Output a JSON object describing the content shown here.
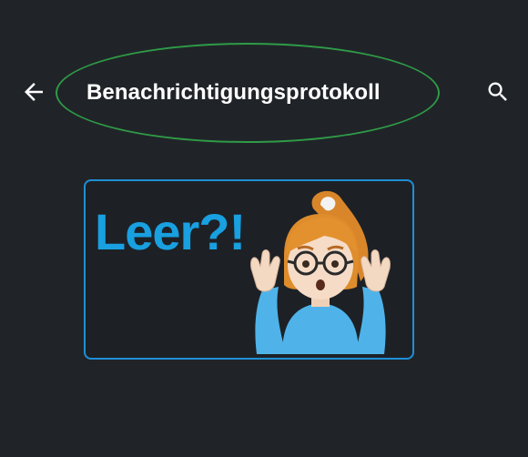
{
  "header": {
    "title": "Benachrichtigungsprotokoll",
    "back_icon": "arrow-left-icon",
    "search_icon": "search-icon",
    "highlight_color": "#2f9a47"
  },
  "empty_state": {
    "text": "Leer?!",
    "text_color": "#18a0e0",
    "border_color": "#1f8fd6",
    "illustration": "shrugging-girl-emoji"
  },
  "colors": {
    "background": "#202428",
    "title": "#ffffff"
  }
}
